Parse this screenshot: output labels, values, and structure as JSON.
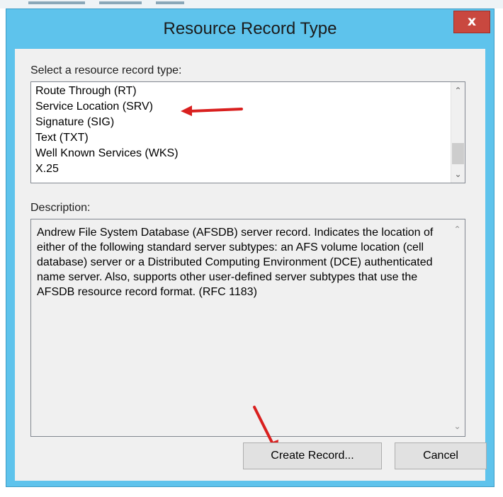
{
  "dialog": {
    "title": "Resource Record Type",
    "close_label": "x"
  },
  "record_types": {
    "label": "Select a resource record type:",
    "items": [
      "Route Through (RT)",
      "Service Location (SRV)",
      "Signature (SIG)",
      "Text (TXT)",
      "Well Known Services (WKS)",
      "X.25"
    ]
  },
  "description": {
    "label": "Description:",
    "text": "Andrew File System Database (AFSDB) server record. Indicates the location of either of the following standard server subtypes: an AFS volume location (cell database) server or a Distributed Computing Environment (DCE) authenticated name server. Also, supports other user-defined server subtypes that use the AFSDB resource record format. (RFC 1183)"
  },
  "buttons": {
    "create_label": "Create Record...",
    "cancel_label": "Cancel"
  },
  "icons": {
    "scroll_up": "scroll-up-icon",
    "scroll_down": "scroll-down-icon",
    "close": "close-icon"
  },
  "colors": {
    "title_bar": "#5ec3ec",
    "close_button": "#c9483f",
    "annotation_arrow": "#d9201f"
  }
}
